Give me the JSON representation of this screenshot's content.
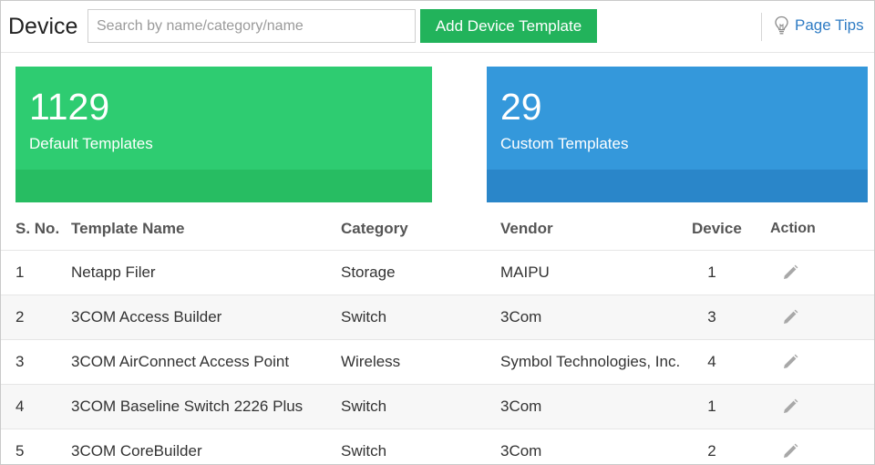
{
  "header": {
    "title": "Device",
    "search_placeholder": "Search by name/category/name",
    "add_button_label": "Add Device Template",
    "page_tips_label": "Page Tips",
    "page_tips_icon": "lightbulb-icon"
  },
  "cards": {
    "default": {
      "count": "1129",
      "label": "Default Templates",
      "color": "#2ecc71"
    },
    "custom": {
      "count": "29",
      "label": "Custom Templates",
      "color": "#3498db"
    }
  },
  "table": {
    "columns": {
      "sno": "S. No.",
      "name": "Template Name",
      "category": "Category",
      "vendor": "Vendor",
      "device": "Device",
      "action": "Action"
    },
    "action_icon": "pencil-icon",
    "rows": [
      {
        "sno": "1",
        "name": "Netapp Filer",
        "category": "Storage",
        "vendor": "MAIPU",
        "device": "1"
      },
      {
        "sno": "2",
        "name": "3COM Access Builder",
        "category": "Switch",
        "vendor": "3Com",
        "device": "3"
      },
      {
        "sno": "3",
        "name": "3COM AirConnect Access Point",
        "category": "Wireless",
        "vendor": "Symbol Technologies, Inc.",
        "device": "4"
      },
      {
        "sno": "4",
        "name": "3COM Baseline Switch 2226 Plus",
        "category": "Switch",
        "vendor": "3Com",
        "device": "1"
      },
      {
        "sno": "5",
        "name": "3COM CoreBuilder",
        "category": "Switch",
        "vendor": "3Com",
        "device": "2"
      }
    ]
  }
}
